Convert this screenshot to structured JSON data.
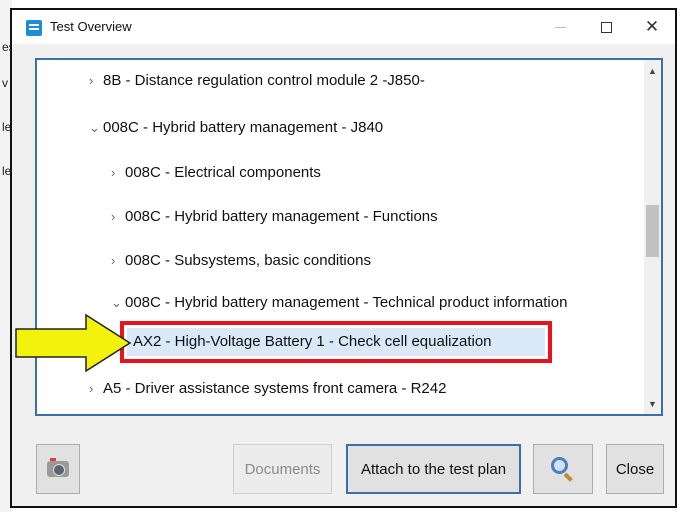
{
  "background": {
    "letters": [
      "es",
      "v",
      "le",
      "le"
    ]
  },
  "window": {
    "title": "Test Overview",
    "accent": "#1a8fd6"
  },
  "tree": {
    "items": [
      {
        "chevron": ">",
        "label": "8B - Distance regulation control module 2 -J850-"
      },
      {
        "chevron": "v",
        "label": "008C - Hybrid battery management  - J840"
      },
      {
        "chevron": ">",
        "label": "008C - Electrical components"
      },
      {
        "chevron": ">",
        "label": "008C - Hybrid battery management - Functions"
      },
      {
        "chevron": ">",
        "label": "008C - Subsystems, basic conditions"
      },
      {
        "chevron": "v",
        "label": "008C - Hybrid battery management - Technical product information"
      },
      {
        "chevron": "",
        "label": "AX2 - High-Voltage Battery 1  - Check cell equalization"
      },
      {
        "chevron": ">",
        "label": "A5 - Driver assistance systems front camera - R242"
      }
    ],
    "selected_index": 6,
    "highlight_color": "#e8131b",
    "arrow_color": "#f2f20c"
  },
  "buttons": {
    "documents": "Documents",
    "attach": "Attach to the test plan",
    "close": "Close"
  }
}
